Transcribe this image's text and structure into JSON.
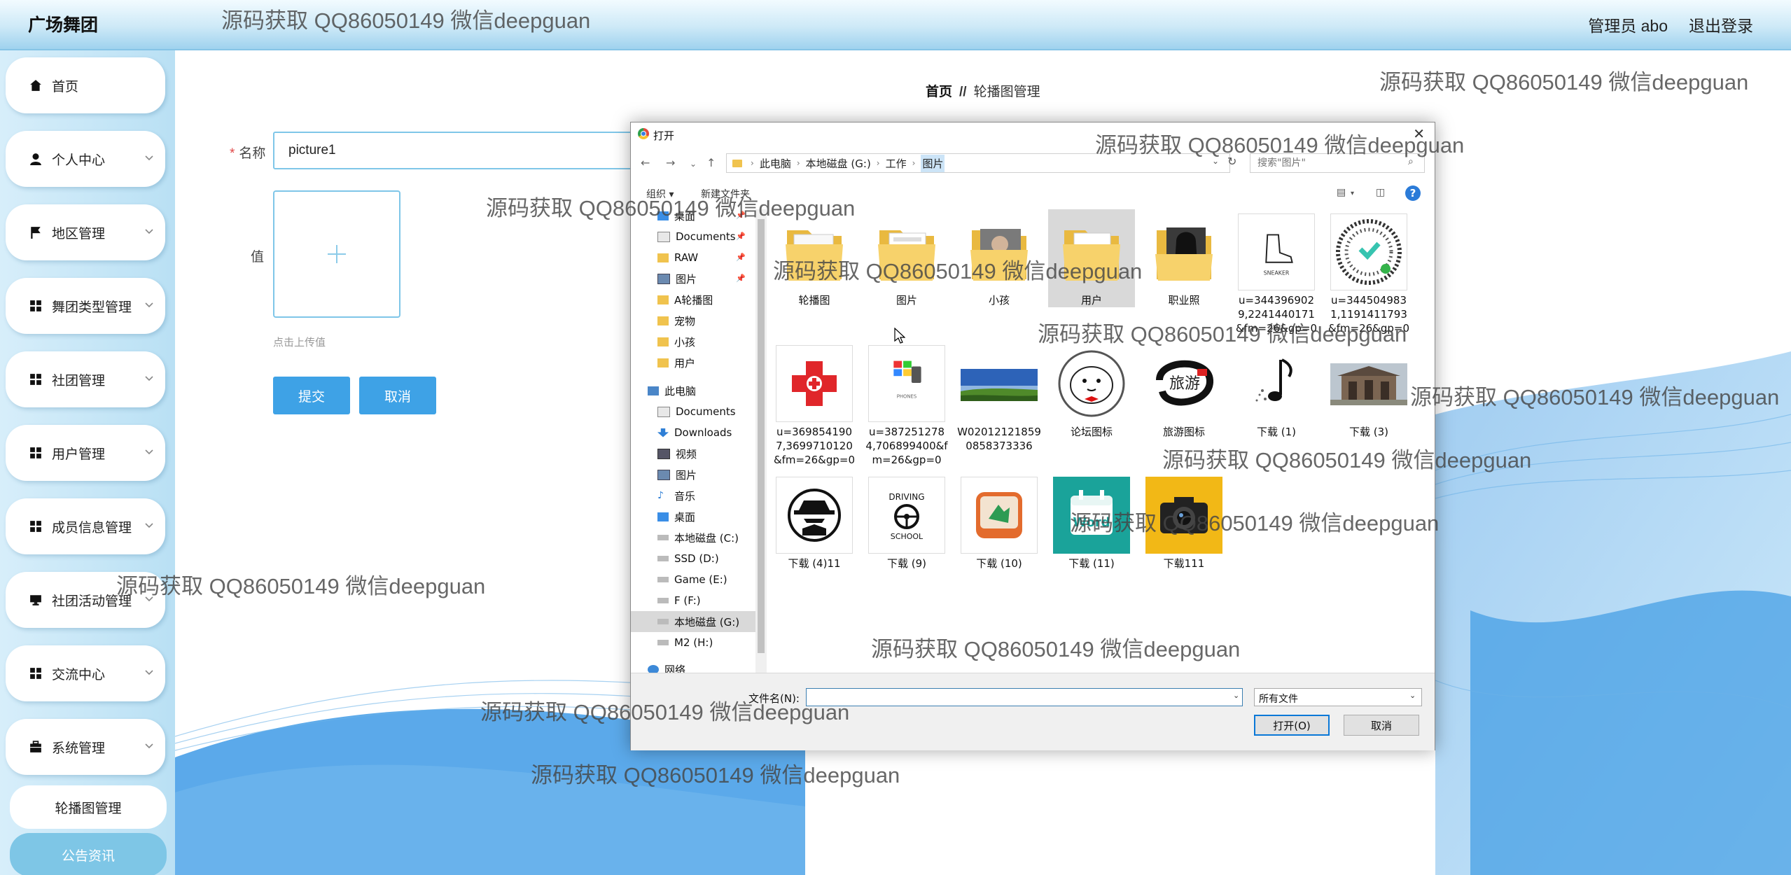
{
  "header": {
    "brand": "广场舞团",
    "user": "管理员 abo",
    "logout": "退出登录"
  },
  "sidebar": {
    "items": [
      {
        "label": "首页",
        "icon": "home-icon",
        "arrow": false
      },
      {
        "label": "个人中心",
        "icon": "user-icon",
        "arrow": true
      },
      {
        "label": "地区管理",
        "icon": "flag-icon",
        "arrow": true
      },
      {
        "label": "舞团类型管理",
        "icon": "grid-icon",
        "arrow": true
      },
      {
        "label": "社团管理",
        "icon": "grid-icon",
        "arrow": true
      },
      {
        "label": "用户管理",
        "icon": "grid-icon",
        "arrow": true
      },
      {
        "label": "成员信息管理",
        "icon": "grid-icon",
        "arrow": true
      },
      {
        "label": "社团活动管理",
        "icon": "monitor-icon",
        "arrow": true
      },
      {
        "label": "交流中心",
        "icon": "grid-icon",
        "arrow": true
      },
      {
        "label": "系统管理",
        "icon": "briefcase-icon",
        "arrow": true
      }
    ],
    "sub_items": [
      {
        "label": "轮播图管理"
      },
      {
        "label": "公告资讯"
      }
    ]
  },
  "breadcrumb": {
    "home": "首页",
    "sep": "//",
    "current": "轮播图管理"
  },
  "form": {
    "required_mark": "*",
    "name_label": "名称",
    "name_value": "picture1",
    "value_label": "值",
    "upload_hint": "点击上传值",
    "submit": "提交",
    "cancel": "取消"
  },
  "dialog": {
    "title": "打开",
    "path": [
      "此电脑",
      "本地磁盘 (G:)",
      "工作",
      "图片"
    ],
    "search_placeholder": "搜索\"图片\"",
    "organize": "组织 ▾",
    "new_folder": "新建文件夹",
    "nav": [
      {
        "label": "桌面",
        "icon": "desktop-icon",
        "pin": true
      },
      {
        "label": "Documents",
        "icon": "document-icon",
        "pin": true
      },
      {
        "label": "RAW",
        "icon": "folder-icon",
        "pin": true
      },
      {
        "label": "图片",
        "icon": "picture-icon",
        "pin": true
      },
      {
        "label": "A轮播图",
        "icon": "folder-icon",
        "pin": false
      },
      {
        "label": "宠物",
        "icon": "folder-icon",
        "pin": false
      },
      {
        "label": "小孩",
        "icon": "folder-icon",
        "pin": false
      },
      {
        "label": "用户",
        "icon": "folder-icon",
        "pin": false
      },
      {
        "label": "此电脑",
        "icon": "computer-icon",
        "pin": false
      },
      {
        "label": "Documents",
        "icon": "document-icon",
        "pin": false
      },
      {
        "label": "Downloads",
        "icon": "download-icon",
        "pin": false
      },
      {
        "label": "视频",
        "icon": "video-icon",
        "pin": false
      },
      {
        "label": "图片",
        "icon": "picture-icon",
        "pin": false
      },
      {
        "label": "音乐",
        "icon": "music-icon",
        "pin": false
      },
      {
        "label": "桌面",
        "icon": "desktop-icon",
        "pin": false
      },
      {
        "label": "本地磁盘 (C:)",
        "icon": "drive-icon",
        "pin": false
      },
      {
        "label": "SSD (D:)",
        "icon": "drive-icon",
        "pin": false
      },
      {
        "label": "Game (E:)",
        "icon": "drive-icon",
        "pin": false
      },
      {
        "label": "F (F:)",
        "icon": "drive-icon",
        "pin": false
      },
      {
        "label": "本地磁盘 (G:)",
        "icon": "drive-icon",
        "pin": false
      },
      {
        "label": "M2 (H:)",
        "icon": "drive-icon",
        "pin": false
      },
      {
        "label": "网络",
        "icon": "network-icon",
        "pin": false
      }
    ],
    "files": [
      {
        "name": "轮播图",
        "kind": "folder-icon"
      },
      {
        "name": "图片",
        "kind": "folder-icon"
      },
      {
        "name": "小孩",
        "kind": "folder-photo-icon"
      },
      {
        "name": "用户",
        "kind": "folder-icon"
      },
      {
        "name": "职业照",
        "kind": "folder-photo-icon"
      },
      {
        "name": "u=3443969029,2241440171&fm=26&gp=0",
        "kind": "sneaker-image"
      },
      {
        "name": "u=3445049831,1191411793&fm=26&gp=0",
        "kind": "qrcode-image"
      },
      {
        "name": "u=3698541907,3699710120&fm=26&gp=0",
        "kind": "red-cross-image"
      },
      {
        "name": "u=3872512784,706899400&fm=26&gp=0",
        "kind": "phone-image"
      },
      {
        "name": "W020121218590858373336",
        "kind": "landscape-image"
      },
      {
        "name": "论坛图标",
        "kind": "cartoon-image"
      },
      {
        "name": "旅游图标",
        "kind": "travel-image"
      },
      {
        "name": "下载 (1)",
        "kind": "music-note-image"
      },
      {
        "name": "下载 (3)",
        "kind": "building-image"
      },
      {
        "name": "下载 (4)11",
        "kind": "spy-image"
      },
      {
        "name": "下载 (9)",
        "kind": "driving-school-image"
      },
      {
        "name": "下载 (10)",
        "kind": "orange-app-image"
      },
      {
        "name": "下载 (11)",
        "kind": "word-calendar-image"
      },
      {
        "name": "下载111",
        "kind": "camera-image"
      }
    ],
    "filename_label": "文件名(N):",
    "filetype": "所有文件",
    "open": "打开(O)",
    "cancel": "取消",
    "thumb_text": {
      "sneaker": "SNEAKER",
      "phones": "PHONES",
      "driving": "DRIVING",
      "school": "SCHOOL",
      "word": "Word",
      "travel": "旅游"
    }
  },
  "watermark": "源码获取 QQ86050149 微信deepguan",
  "colors": {
    "accent": "#3ea2e6",
    "sidebar_active": "#7ec6e6",
    "border": "#7fc6e8"
  }
}
